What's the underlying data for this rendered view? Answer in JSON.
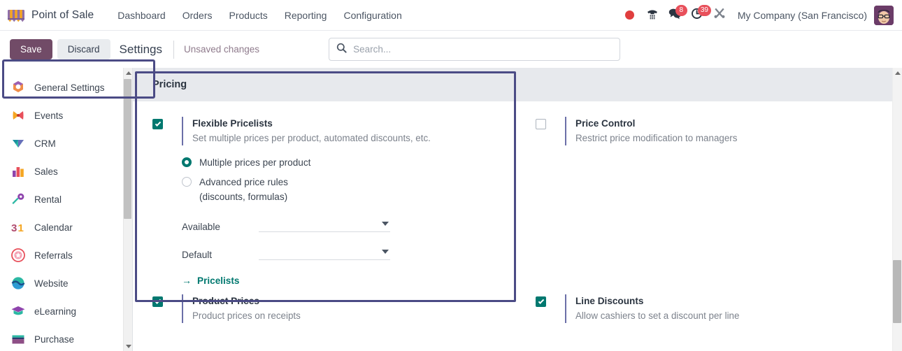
{
  "navbar": {
    "brand": "Point of Sale",
    "brand_logo_icon": "shop-awning-icon",
    "menu": [
      {
        "label": "Dashboard"
      },
      {
        "label": "Orders"
      },
      {
        "label": "Products"
      },
      {
        "label": "Reporting"
      },
      {
        "label": "Configuration"
      }
    ],
    "icons": [
      {
        "name": "recording-dot-icon",
        "color": "#e03e3e"
      },
      {
        "name": "phone-dialpad-icon"
      },
      {
        "name": "messages-icon",
        "badge": "8"
      },
      {
        "name": "activities-clock-icon",
        "badge": "39"
      },
      {
        "name": "developer-tools-icon"
      }
    ],
    "company": "My Company (San Francisco)",
    "avatar_icon": "user-avatar"
  },
  "controlbar": {
    "save_label": "Save",
    "discard_label": "Discard",
    "breadcrumb": "Settings",
    "unsaved_label": "Unsaved changes",
    "search_placeholder": "Search...",
    "search_value": "",
    "search_icon": "search-icon"
  },
  "sidebar": {
    "items": [
      {
        "label": "General Settings",
        "icon": "general-settings-icon"
      },
      {
        "label": "Events",
        "icon": "events-icon"
      },
      {
        "label": "CRM",
        "icon": "crm-icon"
      },
      {
        "label": "Sales",
        "icon": "sales-icon"
      },
      {
        "label": "Rental",
        "icon": "rental-icon"
      },
      {
        "label": "Calendar",
        "icon": "calendar-icon"
      },
      {
        "label": "Referrals",
        "icon": "referrals-icon"
      },
      {
        "label": "Website",
        "icon": "website-icon"
      },
      {
        "label": "eLearning",
        "icon": "elearning-icon"
      },
      {
        "label": "Purchase",
        "icon": "purchase-icon"
      }
    ]
  },
  "section": {
    "title": "Pricing",
    "settings": {
      "flexible_pricelists": {
        "label": "Flexible Pricelists",
        "desc": "Set multiple prices per product, automated discounts, etc.",
        "checked": true
      },
      "price_control": {
        "label": "Price Control",
        "desc": "Restrict price modification to managers",
        "checked": false
      },
      "product_prices": {
        "label": "Product Prices",
        "desc": "Product prices on receipts",
        "checked": true
      },
      "line_discounts": {
        "label": "Line Discounts",
        "desc": "Allow cashiers to set a discount per line",
        "checked": true
      }
    },
    "pricelist_mode": {
      "option_multiple": "Multiple prices per product",
      "option_advanced_l1": "Advanced price rules",
      "option_advanced_l2": "(discounts, formulas)",
      "selected": "multiple"
    },
    "available_field": {
      "label": "Available",
      "value": ""
    },
    "default_field": {
      "label": "Default",
      "value": ""
    },
    "pricelists_link": {
      "arrow": "→",
      "label": "Pricelists"
    }
  }
}
